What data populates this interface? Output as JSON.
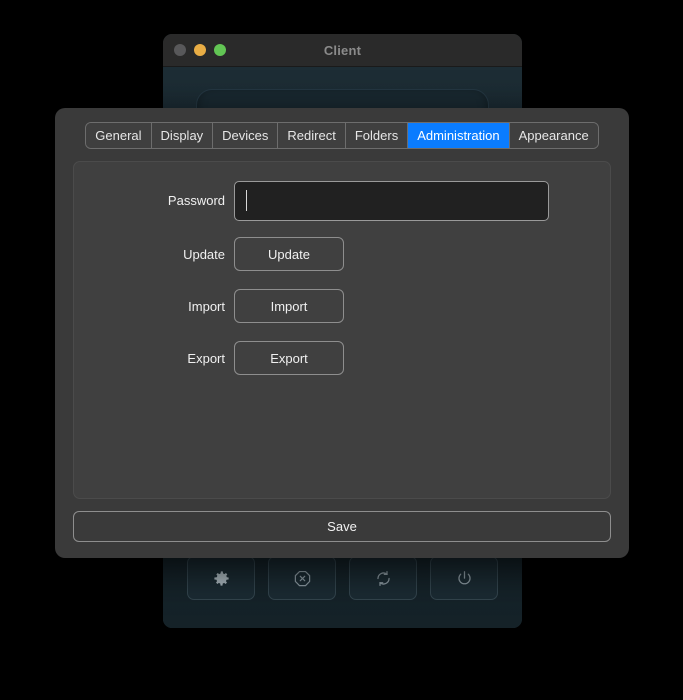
{
  "background_window": {
    "title": "Client",
    "traffic_lights": [
      {
        "name": "close",
        "color": "#58585a"
      },
      {
        "name": "minimize",
        "color": "#e9ad45"
      },
      {
        "name": "maximize",
        "color": "#62c554"
      }
    ],
    "toolbar": [
      {
        "icon": "gear-icon",
        "label": "Settings"
      },
      {
        "icon": "cancel-octagon-icon",
        "label": "Disconnect"
      },
      {
        "icon": "refresh-icon",
        "label": "Refresh"
      },
      {
        "icon": "power-icon",
        "label": "Power"
      }
    ]
  },
  "dialog": {
    "tabs": [
      {
        "label": "General",
        "active": false
      },
      {
        "label": "Display",
        "active": false
      },
      {
        "label": "Devices",
        "active": false
      },
      {
        "label": "Redirect",
        "active": false
      },
      {
        "label": "Folders",
        "active": false
      },
      {
        "label": "Administration",
        "active": true
      },
      {
        "label": "Appearance",
        "active": false
      }
    ],
    "active_tab": "Administration",
    "accent_color": "#0a7cff",
    "form": {
      "password": {
        "label": "Password",
        "value": "",
        "placeholder": ""
      },
      "update": {
        "label": "Update",
        "button": "Update"
      },
      "import": {
        "label": "Import",
        "button": "Import"
      },
      "export": {
        "label": "Export",
        "button": "Export"
      }
    },
    "save_label": "Save"
  }
}
